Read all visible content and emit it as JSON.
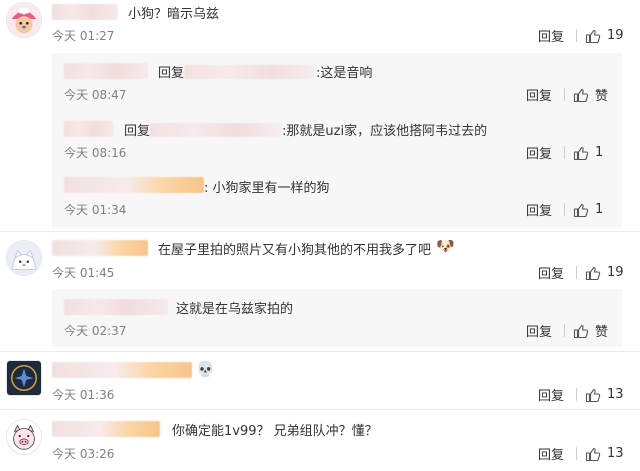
{
  "comments": [
    {
      "text": "小狗？暗示乌兹",
      "time": "今天 01:27",
      "reply": "回复",
      "likes": "19"
    },
    {
      "text": "在屋子里拍的照片又有小狗其他的不用我多了吧",
      "emoji": "🐶",
      "time": "今天 01:45",
      "reply": "回复",
      "likes": "19"
    },
    {
      "text": "",
      "emoji": "💀",
      "time": "今天 01:36",
      "reply": "回复",
      "likes": "13"
    },
    {
      "text": "你确定能1v99？ 兄弟组队冲？懂？",
      "time": "今天 03:26",
      "reply": "回复",
      "likes": "13"
    }
  ],
  "sub_replies_1": [
    {
      "prefix": "回复",
      "text": ":这是音响",
      "time": "今天 08:47",
      "reply": "回复",
      "likes": "赞"
    },
    {
      "prefix": "回复",
      "text": ":那就是uzi家，应该他搭阿韦过去的",
      "time": "今天 08:16",
      "reply": "回复",
      "likes": "1"
    },
    {
      "text": ": 小狗家里有一样的狗",
      "time": "今天 01:34",
      "reply": "回复",
      "likes": "1"
    }
  ],
  "sub_replies_2": [
    {
      "text": "这就是在乌兹家拍的",
      "time": "今天 02:37",
      "reply": "回复",
      "likes": "赞"
    }
  ],
  "icons": {
    "like": "thumbs-up-icon",
    "emoji_dog": "dog-face-emoji",
    "emoji_skull": "skull-emoji"
  },
  "colors": {
    "time": "#808080",
    "panel_bg": "#f7f7f7",
    "text": "#333333"
  }
}
